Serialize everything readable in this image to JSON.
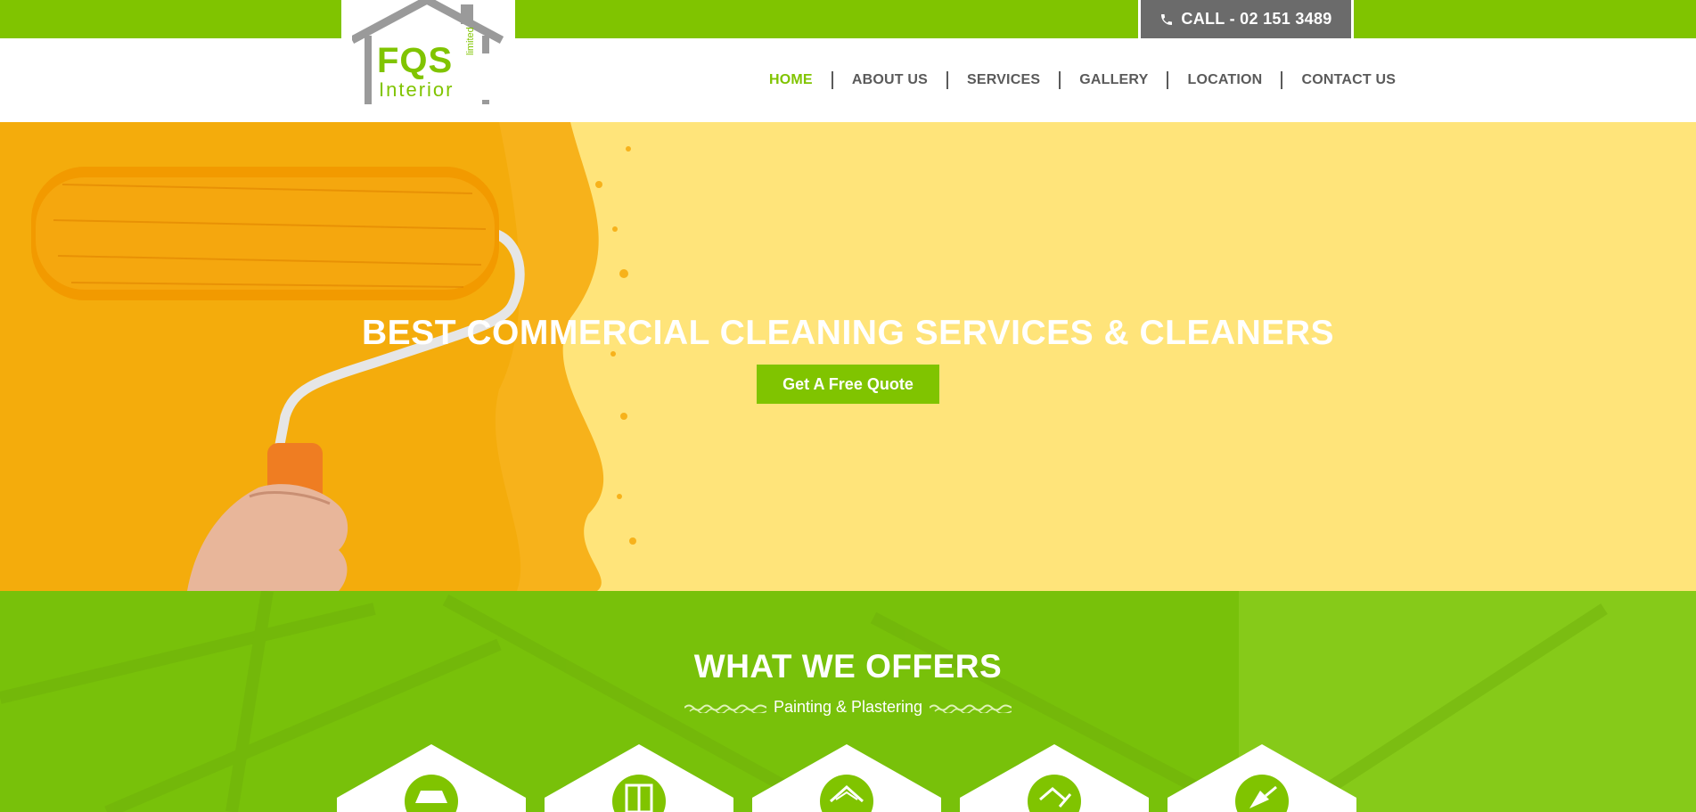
{
  "colors": {
    "brand_green": "#80c400",
    "call_bg": "#6b6b6b",
    "hero_bg": "#ffe47a",
    "nav_text": "#5a5a5a"
  },
  "topbar": {
    "call_label": "CALL - 02 151 3489",
    "call_icon": "phone-icon"
  },
  "logo": {
    "name": "FQS",
    "sub": "Interior",
    "tag": "limited"
  },
  "nav": {
    "items": [
      {
        "label": "HOME",
        "active": true
      },
      {
        "label": "ABOUT US"
      },
      {
        "label": "SERVICES"
      },
      {
        "label": "GALLERY"
      },
      {
        "label": "LOCATION"
      },
      {
        "label": "CONTACT US"
      }
    ]
  },
  "hero": {
    "title": "BEST COMMERCIAL CLEANING SERVICES & CLEANERS",
    "button": "Get A Free Quote"
  },
  "offers": {
    "title": "WHAT WE OFFERS",
    "subtitle": "Painting & Plastering",
    "cards": [
      {
        "icon": "lamp-icon"
      },
      {
        "icon": "door-icon"
      },
      {
        "icon": "house-icon"
      },
      {
        "icon": "house-brush-icon"
      },
      {
        "icon": "trowel-icon"
      }
    ]
  }
}
